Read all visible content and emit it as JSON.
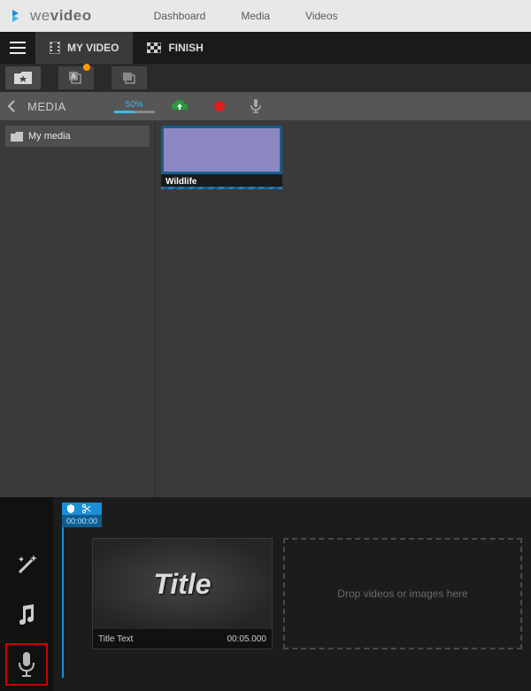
{
  "app": {
    "name": "WeVideo"
  },
  "nav": {
    "dashboard": "Dashboard",
    "media": "Media",
    "videos": "Videos"
  },
  "tabs": {
    "myvideo": "MY VIDEO",
    "finish": "FINISH"
  },
  "mediabar": {
    "label": "MEDIA",
    "progress_percent": "50%",
    "progress_value": 50
  },
  "sidebar": {
    "folder": "My media"
  },
  "clips": [
    {
      "name": "Wildlife"
    }
  ],
  "timeline": {
    "playhead_time": "00:00:00",
    "title_clip": {
      "preview_text": "Title",
      "label": "Title Text",
      "duration": "00:05.000"
    },
    "drop_hint": "Drop videos or images here"
  }
}
